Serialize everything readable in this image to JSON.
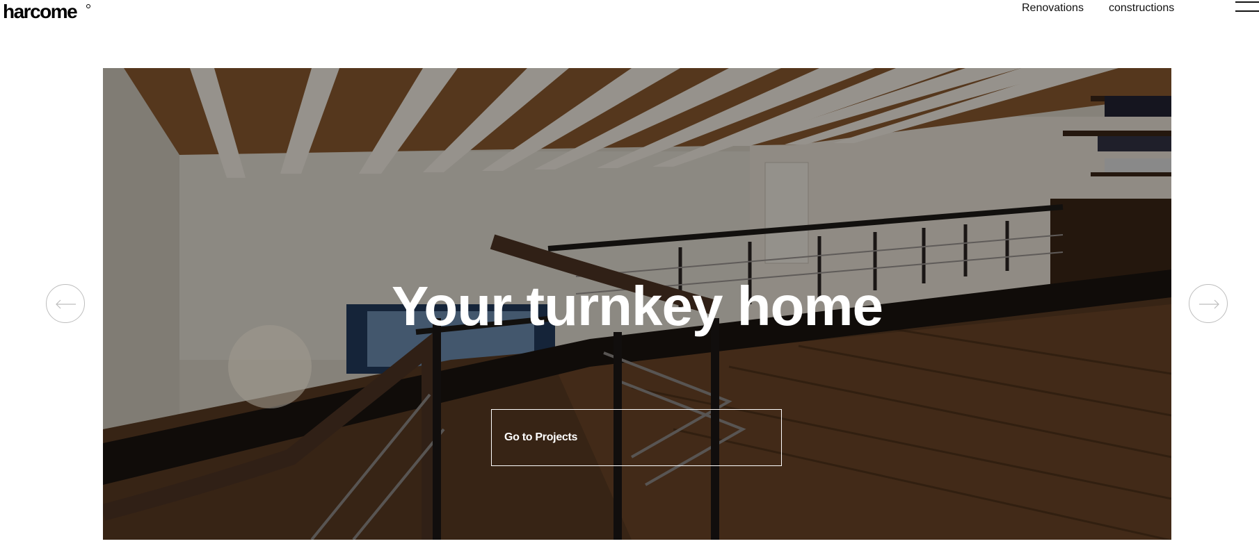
{
  "brand": {
    "logo_text": "harcome"
  },
  "nav": {
    "items": [
      {
        "label": "Renovations"
      },
      {
        "label": "constructions"
      }
    ]
  },
  "hero": {
    "title": "Your turnkey home",
    "cta_label": "Go to Projects"
  },
  "icons": {
    "prev": "arrow-left-icon",
    "next": "arrow-right-icon",
    "menu": "hamburger-menu-icon"
  },
  "colors": {
    "text": "#111111",
    "hero_text": "#ffffff",
    "arrow_border": "#bdbdbd"
  }
}
